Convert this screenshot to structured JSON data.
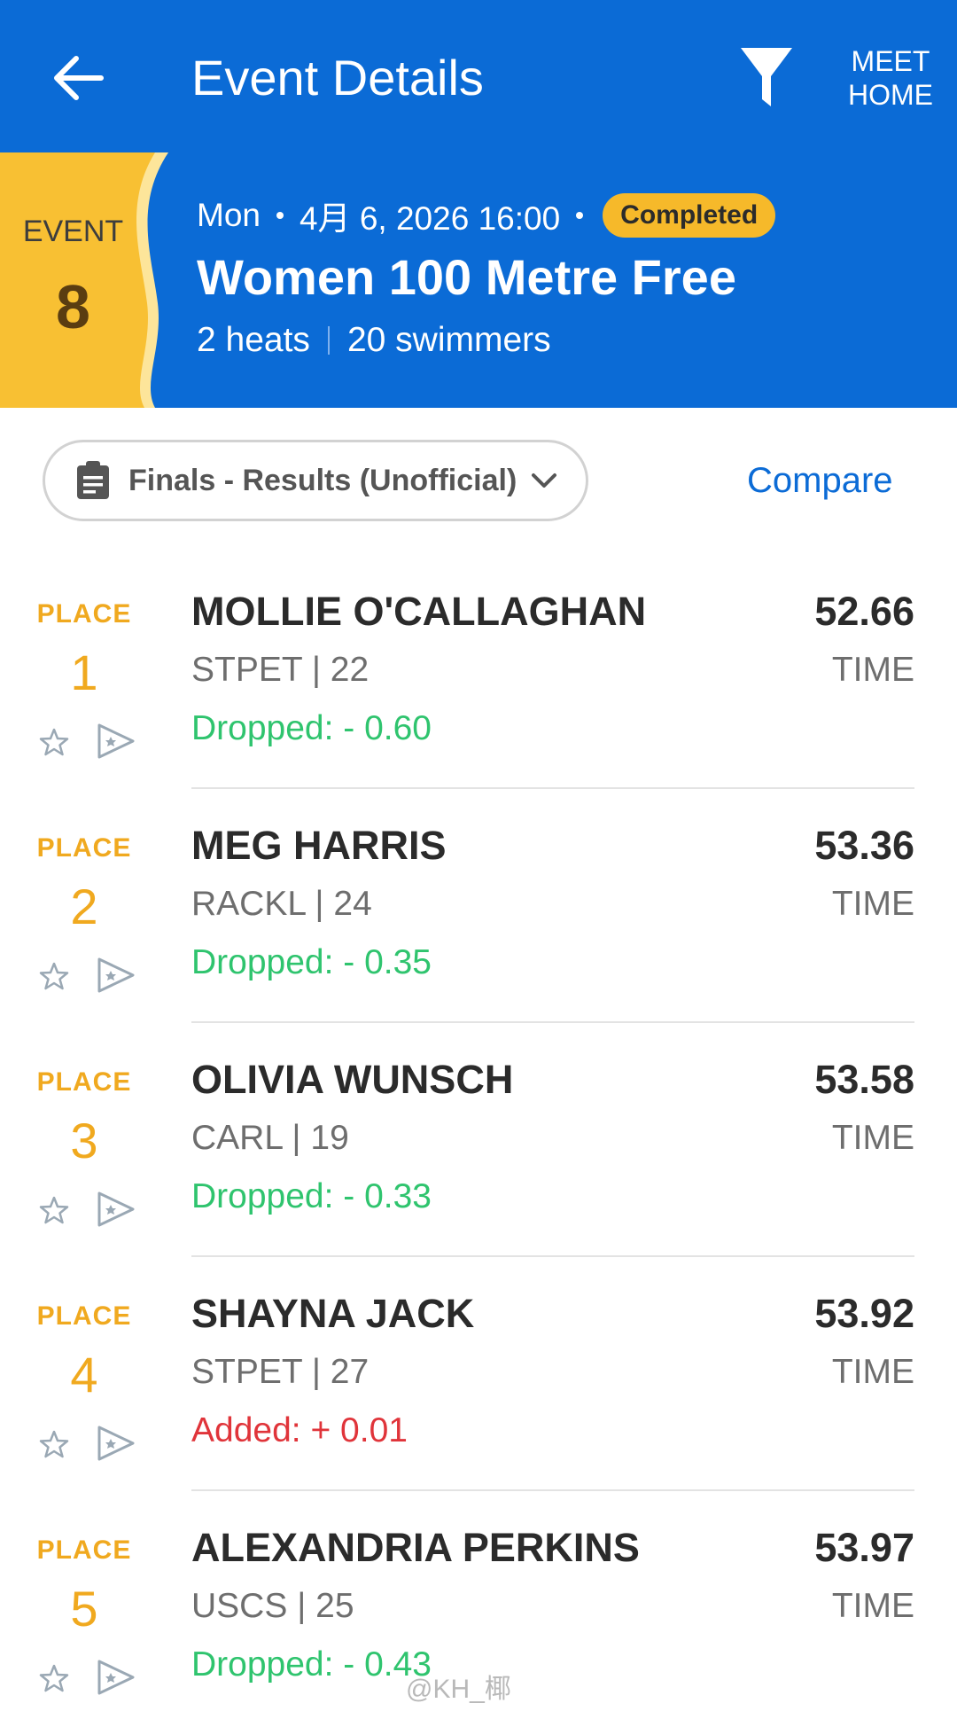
{
  "app_bar": {
    "title": "Event Details",
    "meet_home_line1": "MEET",
    "meet_home_line2": "HOME"
  },
  "event": {
    "label": "EVENT",
    "number": "8",
    "day": "Mon",
    "date_time": "4月 6, 2026 16:00",
    "status": "Completed",
    "name": "Women 100 Metre Free",
    "heats": "2 heats",
    "swimmers": "20 swimmers"
  },
  "controls": {
    "results_select": "Finals - Results (Unofficial)",
    "compare": "Compare"
  },
  "colors": {
    "primary": "#0b6bd6",
    "accent": "#f6b92a",
    "dropped": "#2fc46e",
    "added": "#e0343a"
  },
  "results": [
    {
      "place_label": "PLACE",
      "place": "1",
      "name": "MOLLIE O'CALLAGHAN",
      "info": "STPET | 22",
      "diff": "Dropped: - 0.60",
      "diff_type": "dropped",
      "time": "52.66",
      "time_label": "TIME"
    },
    {
      "place_label": "PLACE",
      "place": "2",
      "name": "MEG HARRIS",
      "info": "RACKL | 24",
      "diff": "Dropped: - 0.35",
      "diff_type": "dropped",
      "time": "53.36",
      "time_label": "TIME"
    },
    {
      "place_label": "PLACE",
      "place": "3",
      "name": "OLIVIA WUNSCH",
      "info": "CARL | 19",
      "diff": "Dropped: - 0.33",
      "diff_type": "dropped",
      "time": "53.58",
      "time_label": "TIME"
    },
    {
      "place_label": "PLACE",
      "place": "4",
      "name": "SHAYNA JACK",
      "info": "STPET | 27",
      "diff": "Added: + 0.01",
      "diff_type": "added",
      "time": "53.92",
      "time_label": "TIME"
    },
    {
      "place_label": "PLACE",
      "place": "5",
      "name": "ALEXANDRIA PERKINS",
      "info": "USCS | 25",
      "diff": "Dropped: - 0.43",
      "diff_type": "dropped",
      "time": "53.97",
      "time_label": "TIME"
    }
  ],
  "watermark": "@KH_椰"
}
